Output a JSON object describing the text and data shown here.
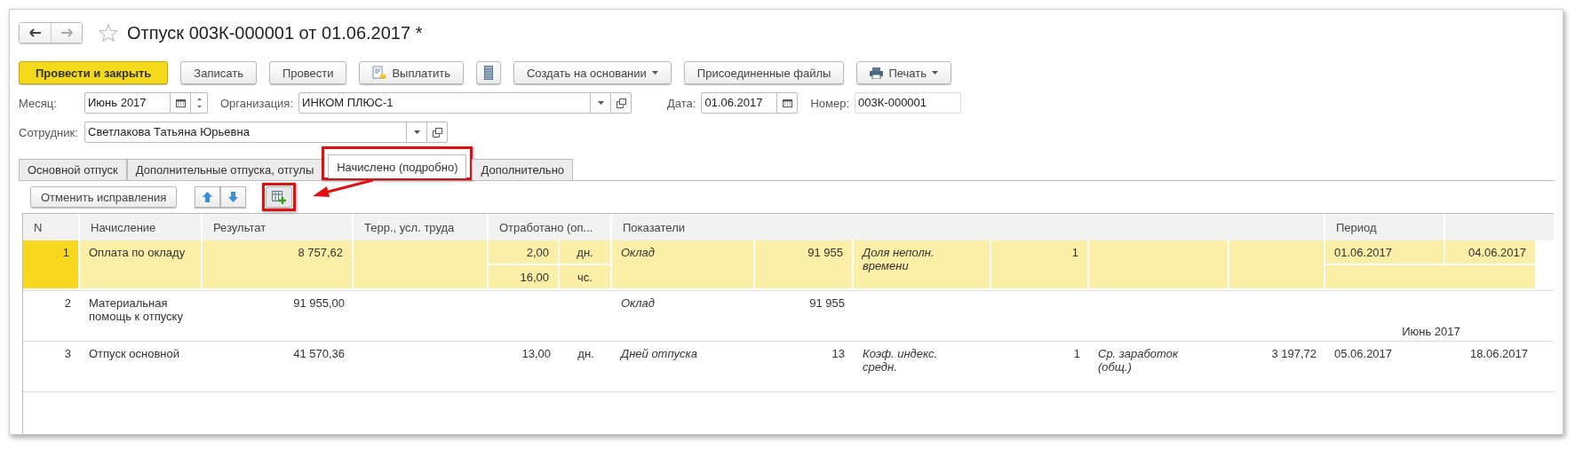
{
  "window": {
    "title": "Отпуск 003К-000001 от 01.06.2017 *",
    "favorite": false
  },
  "commands": [
    {
      "label": "Провести и закрыть",
      "kind": "primary"
    },
    {
      "label": "Записать",
      "kind": "plain"
    },
    {
      "label": "Провести",
      "kind": "plain"
    },
    {
      "label": "Выплатить",
      "kind": "pay"
    },
    {
      "kind": "list"
    },
    {
      "label": "Создать на основании",
      "kind": "menu"
    },
    {
      "label": "Присоединенные файлы",
      "kind": "plain"
    },
    {
      "label": "Печать",
      "kind": "print"
    }
  ],
  "fields_row": [
    {
      "label": "Месяц:",
      "value": "Июнь 2017",
      "kind": "month"
    },
    {
      "label": "Организация:",
      "value": "ИНКОМ ПЛЮС-1",
      "kind": "ref"
    },
    {
      "label": "Дата:",
      "value": "01.06.2017",
      "kind": "date"
    },
    {
      "label": "Номер:",
      "value": "003К-000001",
      "kind": "text"
    }
  ],
  "employee": {
    "label": "Сотрудник:",
    "value": "Светлакова Татьяна Юрьевна"
  },
  "tabs": [
    {
      "label": "Основной отпуск",
      "selected": false,
      "highlighted": false
    },
    {
      "label": "Дополнительные отпуска, отгулы",
      "selected": false,
      "highlighted": false
    },
    {
      "label": "Начислено (подробно)",
      "selected": true,
      "highlighted": true
    },
    {
      "label": "Дополнительно",
      "selected": false,
      "highlighted": false
    }
  ],
  "toolbar": {
    "cancel": "Отменить исправления",
    "add_column_highlighted": true,
    "callout_arrow": true
  },
  "table": {
    "columns": [
      "N",
      "Начисление",
      "Результат",
      "Терр., усл. труда",
      "Отработано (оп...",
      "Показатели",
      "Период"
    ],
    "rows": [
      {
        "n": "1",
        "accrual": "Оплата по окладу",
        "result": "8 757,62",
        "selected": true,
        "worked": [
          {
            "value": "2,00",
            "unit": "дн."
          },
          {
            "value": "16,00",
            "unit": "чс."
          }
        ],
        "indicators": [
          {
            "name": "Оклад",
            "value": "91 955"
          },
          {
            "name": "Доля неполн. времени",
            "value": "1"
          }
        ],
        "period": {
          "start": "01.06.2017",
          "end": "04.06.2017"
        }
      },
      {
        "n": "2",
        "accrual": "Материальная помощь к отпуску",
        "result": "91 955,00",
        "selected": false,
        "worked": [],
        "indicators": [
          {
            "name": "Оклад",
            "value": "91 955"
          }
        ],
        "period": {
          "month": "Июнь 2017"
        }
      },
      {
        "n": "3",
        "accrual": "Отпуск основной",
        "result": "41 570,36",
        "selected": false,
        "worked": [
          {
            "value": "13,00",
            "unit": "дн."
          }
        ],
        "indicators": [
          {
            "name": "Дней отпуска",
            "value": "13"
          },
          {
            "name": "Коэф. индекс. средн.",
            "value": "1"
          },
          {
            "name": "Ср. заработок (общ.)",
            "value": "3 197,72"
          }
        ],
        "period": {
          "start": "05.06.2017",
          "end": "18.06.2017"
        }
      }
    ]
  }
}
